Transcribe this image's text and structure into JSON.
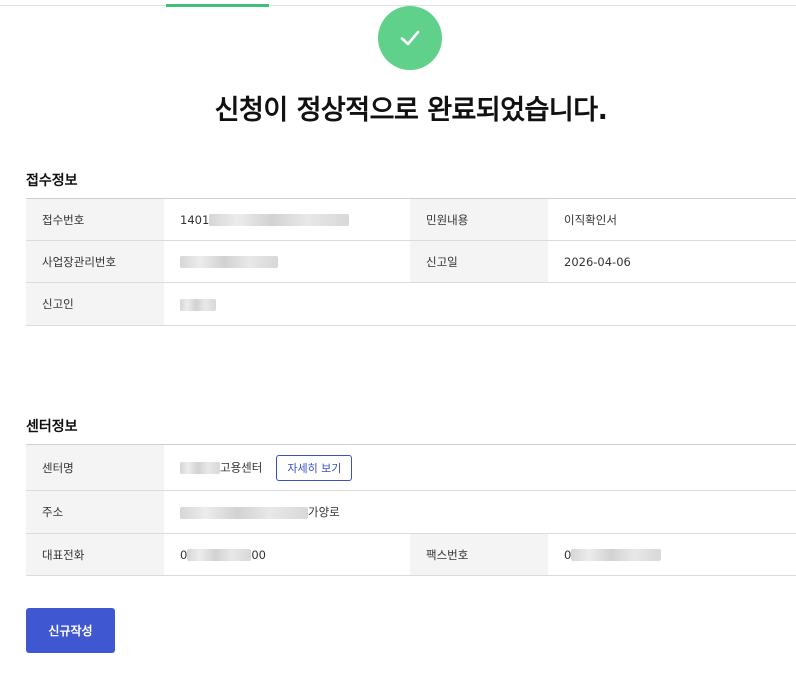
{
  "header": {
    "title": "신청이 정상적으로 완료되었습니다."
  },
  "receipt": {
    "section_title": "접수정보",
    "receipt_no_label": "접수번호",
    "receipt_no_value": "1401",
    "petition_label": "민원내용",
    "petition_value": "이직확인서",
    "workplace_no_label": "사업장관리번호",
    "report_date_label": "신고일",
    "report_date_value": "2026-04-06",
    "reporter_label": "신고인"
  },
  "center": {
    "section_title": "센터정보",
    "name_label": "센터명",
    "name_suffix": "고용센터",
    "detail_button": "자세히 보기",
    "address_label": "주소",
    "address_suffix": "가양로",
    "phone_label": "대표전화",
    "phone_prefix": "0",
    "phone_suffix": "00",
    "fax_label": "팩스번호",
    "fax_prefix": "0"
  },
  "actions": {
    "new_label": "신규작성"
  },
  "colors": {
    "success": "#5fd18b",
    "primary": "#3f57d1",
    "tab_indicator": "#3fbf77"
  },
  "icons": {
    "success": "check-icon"
  }
}
